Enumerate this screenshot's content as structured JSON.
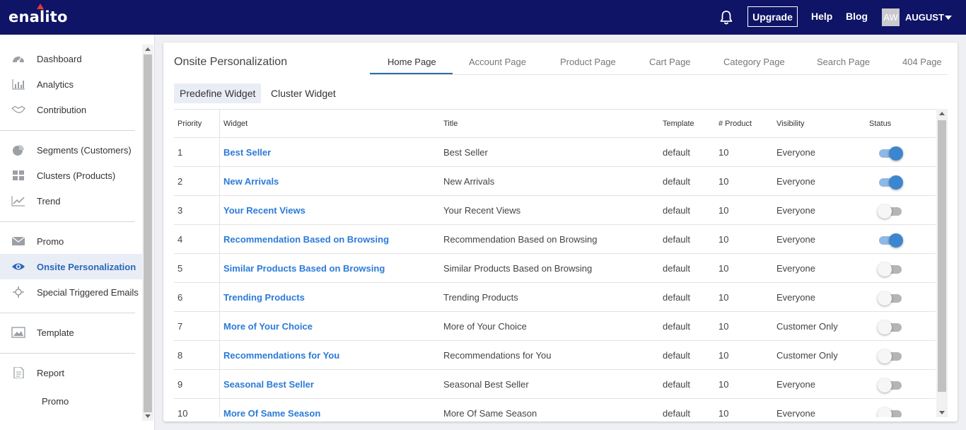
{
  "header": {
    "logo": "enalito",
    "upgrade_label": "Upgrade",
    "help_label": "Help",
    "blog_label": "Blog",
    "avatar_initials": "AW",
    "user_name": "AUGUST",
    "bg_color": "#0f1466"
  },
  "sidebar": {
    "items": [
      {
        "label": "Dashboard",
        "icon": "dashboard-icon"
      },
      {
        "label": "Analytics",
        "icon": "bar-chart-icon"
      },
      {
        "label": "Contribution",
        "icon": "handshake-icon"
      },
      {
        "label": "Segments (Customers)",
        "icon": "pie-chart-icon"
      },
      {
        "label": "Clusters (Products)",
        "icon": "grid-icon"
      },
      {
        "label": "Trend",
        "icon": "trend-icon"
      },
      {
        "label": "Promo",
        "icon": "envelope-icon"
      },
      {
        "label": "Onsite Personalization",
        "icon": "eye-icon"
      },
      {
        "label": "Special Triggered Emails",
        "icon": "crosshair-icon"
      },
      {
        "label": "Template",
        "icon": "image-icon"
      },
      {
        "label": "Report",
        "icon": "document-icon"
      },
      {
        "label": "Promo",
        "icon": ""
      }
    ]
  },
  "main": {
    "title": "Onsite Personalization",
    "tabs": [
      "Home Page",
      "Account Page",
      "Product Page",
      "Cart Page",
      "Category Page",
      "Search Page",
      "404 Page"
    ],
    "subtabs": [
      "Predefine Widget",
      "Cluster Widget"
    ],
    "table": {
      "headers": [
        "Priority",
        "Widget",
        "Title",
        "Template",
        "# Product",
        "Visibility",
        "Status"
      ],
      "rows": [
        {
          "priority": "1",
          "widget": "Best Seller",
          "title": "Best Seller",
          "template": "default",
          "product": "10",
          "visibility": "Everyone",
          "status": true
        },
        {
          "priority": "2",
          "widget": "New Arrivals",
          "title": "New Arrivals",
          "template": "default",
          "product": "10",
          "visibility": "Everyone",
          "status": true
        },
        {
          "priority": "3",
          "widget": "Your Recent Views",
          "title": "Your Recent Views",
          "template": "default",
          "product": "10",
          "visibility": "Everyone",
          "status": false
        },
        {
          "priority": "4",
          "widget": "Recommendation Based on Browsing",
          "title": "Recommendation Based on Browsing",
          "template": "default",
          "product": "10",
          "visibility": "Everyone",
          "status": true
        },
        {
          "priority": "5",
          "widget": "Similar Products Based on Browsing",
          "title": "Similar Products Based on Browsing",
          "template": "default",
          "product": "10",
          "visibility": "Everyone",
          "status": false
        },
        {
          "priority": "6",
          "widget": "Trending Products",
          "title": "Trending Products",
          "template": "default",
          "product": "10",
          "visibility": "Everyone",
          "status": false
        },
        {
          "priority": "7",
          "widget": "More of Your Choice",
          "title": "More of Your Choice",
          "template": "default",
          "product": "10",
          "visibility": "Customer Only",
          "status": false
        },
        {
          "priority": "8",
          "widget": "Recommendations for You",
          "title": "Recommendations for You",
          "template": "default",
          "product": "10",
          "visibility": "Customer Only",
          "status": false
        },
        {
          "priority": "9",
          "widget": "Seasonal Best Seller",
          "title": "Seasonal Best Seller",
          "template": "default",
          "product": "10",
          "visibility": "Everyone",
          "status": false
        },
        {
          "priority": "10",
          "widget": "More Of Same Season",
          "title": "More Of Same Season",
          "template": "default",
          "product": "10",
          "visibility": "Everyone",
          "status": false
        }
      ]
    }
  }
}
